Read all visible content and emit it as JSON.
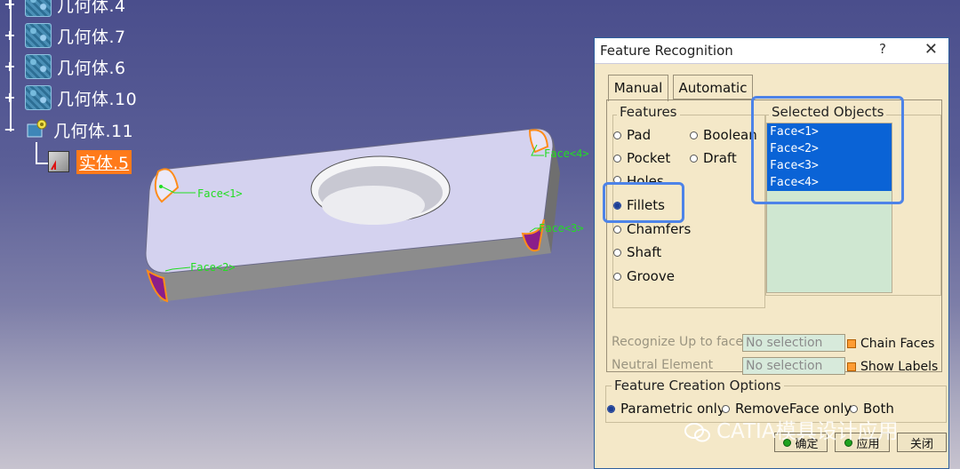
{
  "tree": {
    "nodes": [
      {
        "label": "几何体.4"
      },
      {
        "label": "几何体.7"
      },
      {
        "label": "几何体.6"
      },
      {
        "label": "几何体.10"
      },
      {
        "label": "几何体.11"
      }
    ],
    "child_label": "实体.5"
  },
  "viewport": {
    "face_tags": [
      "Face<1>",
      "Face<2>",
      "Face<3>",
      "Face<4>"
    ]
  },
  "dialog": {
    "title": "Feature Recognition",
    "help": "?",
    "close": "✕",
    "tabs": [
      "Manual",
      "Automatic"
    ],
    "features_legend": "Features",
    "features": [
      "Pad",
      "Boolean",
      "Pocket",
      "Draft",
      "Holes",
      "Fillets",
      "Chamfers",
      "Shaft",
      "Groove"
    ],
    "selected_feature": "Fillets",
    "selected_objects_legend": "Selected Objects",
    "selected_objects": [
      "Face<1>",
      "Face<2>",
      "Face<3>",
      "Face<4>"
    ],
    "recognize_label": "Recognize Up to face",
    "recognize_value": "No selection",
    "neutral_label": "Neutral Element",
    "neutral_value": "No selection",
    "chain_faces_label": "Chain Faces",
    "show_labels_label": "Show Labels",
    "creation_legend": "Feature Creation Options",
    "creation_options": [
      "Parametric only",
      "RemoveFace only",
      "Both"
    ],
    "ok_label": "确定",
    "apply_label": "应用",
    "close_label": "关闭"
  },
  "watermark": "CATIA模具设计应用",
  "colors": {
    "highlight_blue": "#4d83e8",
    "selection_blue": "#0a63d6",
    "face_tag_green": "#22dd22",
    "solid_label_orange": "#ff7a1a"
  }
}
